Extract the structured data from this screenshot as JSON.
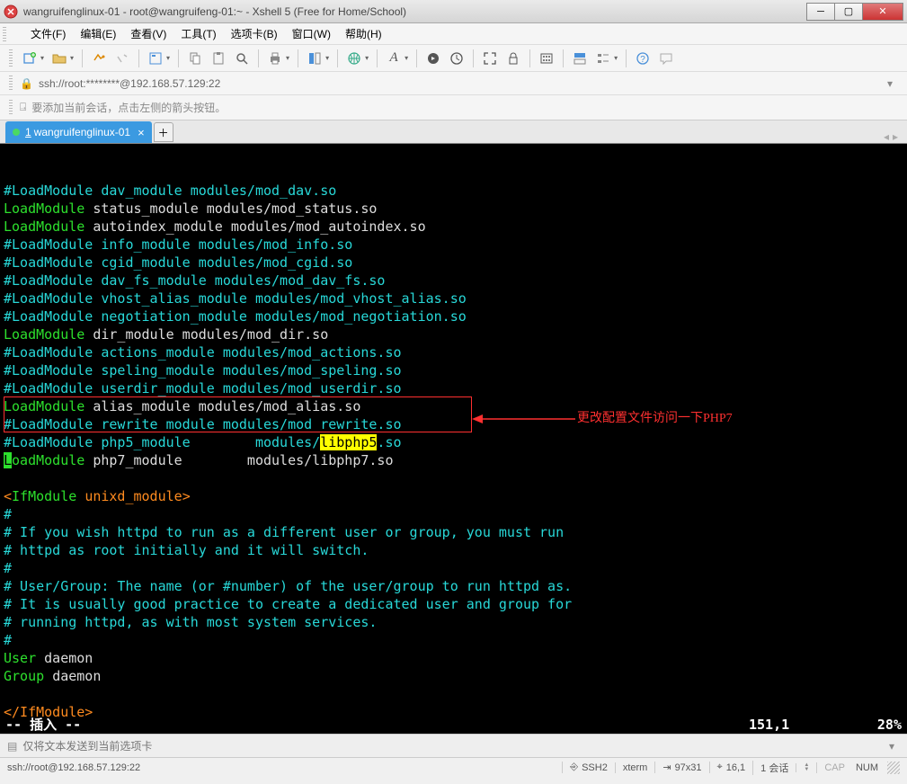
{
  "window": {
    "title": "wangruifenglinux-01 - root@wangruifeng-01:~ - Xshell 5 (Free for Home/School)"
  },
  "menu": {
    "items": [
      "文件(F)",
      "编辑(E)",
      "查看(V)",
      "工具(T)",
      "选项卡(B)",
      "窗口(W)",
      "帮助(H)"
    ]
  },
  "address": {
    "url": "ssh://root:********@192.168.57.129:22"
  },
  "infobar": {
    "text": "要添加当前会话，点击左侧的箭头按钮。"
  },
  "tab": {
    "prefix": "1",
    "label": "wangruifenglinux-01"
  },
  "terminal": {
    "lines": [
      {
        "segs": [
          {
            "t": "#LoadModule dav_module modules/mod_dav.so",
            "c": "c-cyan"
          }
        ]
      },
      {
        "segs": [
          {
            "t": "LoadModule ",
            "c": "c-green"
          },
          {
            "t": "status_module modules/mod_status.so",
            "c": "c-white"
          }
        ]
      },
      {
        "segs": [
          {
            "t": "LoadModule ",
            "c": "c-green"
          },
          {
            "t": "autoindex_module modules/mod_autoindex.so",
            "c": "c-white"
          }
        ]
      },
      {
        "segs": [
          {
            "t": "#LoadModule info_module modules/mod_info.so",
            "c": "c-cyan"
          }
        ]
      },
      {
        "segs": [
          {
            "t": "#LoadModule cgid_module modules/mod_cgid.so",
            "c": "c-cyan"
          }
        ]
      },
      {
        "segs": [
          {
            "t": "#LoadModule dav_fs_module modules/mod_dav_fs.so",
            "c": "c-cyan"
          }
        ]
      },
      {
        "segs": [
          {
            "t": "#LoadModule vhost_alias_module modules/mod_vhost_alias.so",
            "c": "c-cyan"
          }
        ]
      },
      {
        "segs": [
          {
            "t": "#LoadModule negotiation_module modules/mod_negotiation.so",
            "c": "c-cyan"
          }
        ]
      },
      {
        "segs": [
          {
            "t": "LoadModule ",
            "c": "c-green"
          },
          {
            "t": "dir_module modules/mod_dir.so",
            "c": "c-white"
          }
        ]
      },
      {
        "segs": [
          {
            "t": "#LoadModule actions_module modules/mod_actions.so",
            "c": "c-cyan"
          }
        ]
      },
      {
        "segs": [
          {
            "t": "#LoadModule speling_module modules/mod_speling.so",
            "c": "c-cyan"
          }
        ]
      },
      {
        "segs": [
          {
            "t": "#LoadModule userdir_module modules/mod_userdir.so",
            "c": "c-cyan"
          }
        ]
      },
      {
        "segs": [
          {
            "t": "LoadModule ",
            "c": "c-green"
          },
          {
            "t": "alias_module modules/mod_alias.so",
            "c": "c-white"
          }
        ]
      },
      {
        "segs": [
          {
            "t": "#LoadModule rewrite_module modules/mod_rewrite.so",
            "c": "c-cyan"
          }
        ]
      },
      {
        "segs": [
          {
            "t": "#LoadModule php5_module        modules/",
            "c": "c-cyan"
          },
          {
            "t": "libphp5",
            "c": "c-yellow-bg"
          },
          {
            "t": ".so",
            "c": "c-cyan"
          }
        ]
      },
      {
        "segs": [
          {
            "t": "L",
            "c": "c-green-bg"
          },
          {
            "t": "oadModule ",
            "c": "c-green"
          },
          {
            "t": "php7_module        modules/libphp7.so",
            "c": "c-white"
          }
        ]
      },
      {
        "segs": [
          {
            "t": "",
            "c": ""
          }
        ]
      },
      {
        "segs": [
          {
            "t": "<",
            "c": "c-orange"
          },
          {
            "t": "IfModule ",
            "c": "c-green"
          },
          {
            "t": "unixd_module",
            "c": "c-orange"
          },
          {
            "t": ">",
            "c": "c-orange"
          }
        ]
      },
      {
        "segs": [
          {
            "t": "#",
            "c": "c-cyan"
          }
        ]
      },
      {
        "segs": [
          {
            "t": "# If you wish httpd to run as a different user or group, you must run",
            "c": "c-cyan"
          }
        ]
      },
      {
        "segs": [
          {
            "t": "# httpd as root initially and it will switch.",
            "c": "c-cyan"
          }
        ]
      },
      {
        "segs": [
          {
            "t": "#",
            "c": "c-cyan"
          }
        ]
      },
      {
        "segs": [
          {
            "t": "# User/Group: The name (or #number) of the user/group to run httpd as.",
            "c": "c-cyan"
          }
        ]
      },
      {
        "segs": [
          {
            "t": "# It is usually good practice to create a dedicated user and group for",
            "c": "c-cyan"
          }
        ]
      },
      {
        "segs": [
          {
            "t": "# running httpd, as with most system services.",
            "c": "c-cyan"
          }
        ]
      },
      {
        "segs": [
          {
            "t": "#",
            "c": "c-cyan"
          }
        ]
      },
      {
        "segs": [
          {
            "t": "User ",
            "c": "c-green"
          },
          {
            "t": "daemon",
            "c": "c-white"
          }
        ]
      },
      {
        "segs": [
          {
            "t": "Group ",
            "c": "c-green"
          },
          {
            "t": "daemon",
            "c": "c-white"
          }
        ]
      },
      {
        "segs": [
          {
            "t": "",
            "c": ""
          }
        ]
      },
      {
        "segs": [
          {
            "t": "</IfModule>",
            "c": "c-orange"
          }
        ]
      }
    ],
    "mode": "-- 插入 --",
    "pos": "151,1",
    "percent": "28%"
  },
  "annotation": {
    "text": "更改配置文件访问一下PHP7"
  },
  "sendbar": {
    "placeholder": "仅将文本发送到当前选项卡"
  },
  "footer": {
    "conn": "ssh://root@192.168.57.129:22",
    "proto": "SSH2",
    "term": "xterm",
    "size": "97x31",
    "cursor": "16,1",
    "sess": "1 会话",
    "cap": "CAP",
    "num": "NUM"
  }
}
